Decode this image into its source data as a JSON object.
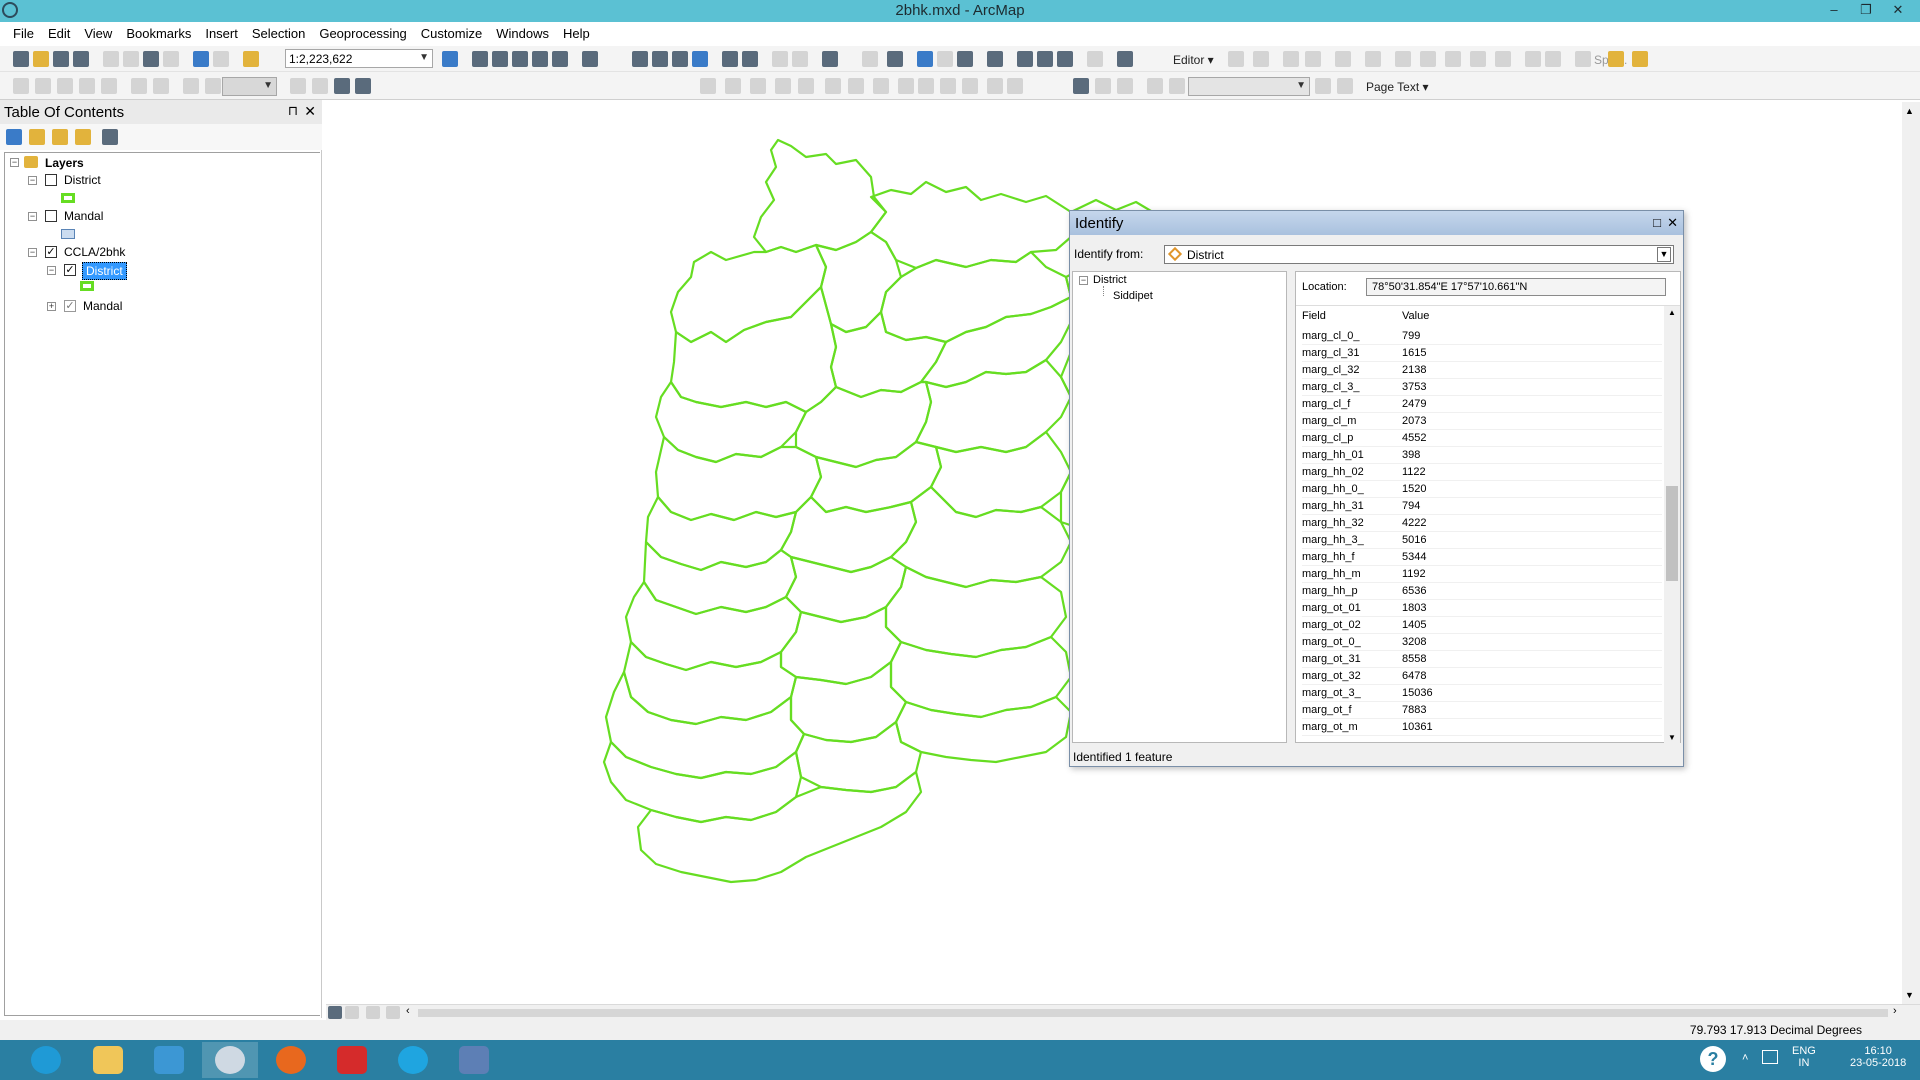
{
  "window": {
    "title": "2bhk.mxd - ArcMap",
    "min": "–",
    "max": "❐",
    "close": "✕"
  },
  "menu": [
    "File",
    "Edit",
    "View",
    "Bookmarks",
    "Insert",
    "Selection",
    "Geoprocessing",
    "Customize",
    "Windows",
    "Help"
  ],
  "toolbar": {
    "scale": "1:2,223,622",
    "editor": "Editor ▾",
    "split": "Split...",
    "page_text": "Page Text ▾"
  },
  "toc": {
    "title": "Table Of Contents",
    "pin": "⊓",
    "close": "✕",
    "layers_label": "Layers",
    "items": [
      {
        "label": "District"
      },
      {
        "label": "Mandal"
      },
      {
        "label": "CCLA/2bhk"
      },
      {
        "label": "District"
      },
      {
        "label": "Mandal"
      }
    ]
  },
  "identify": {
    "title": "Identify",
    "max": "□",
    "close": "✕",
    "from_label": "Identify from:",
    "from_value": "District",
    "tree_root": "District",
    "tree_child": "Siddipet",
    "location_label": "Location:",
    "location_value": "78°50'31.854\"E  17°57'10.661\"N",
    "col_field": "Field",
    "col_value": "Value",
    "rows": [
      {
        "f": "marg_cl_0_",
        "v": "799"
      },
      {
        "f": "marg_cl_31",
        "v": "1615"
      },
      {
        "f": "marg_cl_32",
        "v": "2138"
      },
      {
        "f": "marg_cl_3_",
        "v": "3753"
      },
      {
        "f": "marg_cl_f",
        "v": "2479"
      },
      {
        "f": "marg_cl_m",
        "v": "2073"
      },
      {
        "f": "marg_cl_p",
        "v": "4552"
      },
      {
        "f": "marg_hh_01",
        "v": "398"
      },
      {
        "f": "marg_hh_02",
        "v": "1122"
      },
      {
        "f": "marg_hh_0_",
        "v": "1520"
      },
      {
        "f": "marg_hh_31",
        "v": "794"
      },
      {
        "f": "marg_hh_32",
        "v": "4222"
      },
      {
        "f": "marg_hh_3_",
        "v": "5016"
      },
      {
        "f": "marg_hh_f",
        "v": "5344"
      },
      {
        "f": "marg_hh_m",
        "v": "1192"
      },
      {
        "f": "marg_hh_p",
        "v": "6536"
      },
      {
        "f": "marg_ot_01",
        "v": "1803"
      },
      {
        "f": "marg_ot_02",
        "v": "1405"
      },
      {
        "f": "marg_ot_0_",
        "v": "3208"
      },
      {
        "f": "marg_ot_31",
        "v": "8558"
      },
      {
        "f": "marg_ot_32",
        "v": "6478"
      },
      {
        "f": "marg_ot_3_",
        "v": "15036"
      },
      {
        "f": "marg_ot_f",
        "v": "7883"
      },
      {
        "f": "marg_ot_m",
        "v": "10361"
      }
    ],
    "footer": "Identified 1 feature"
  },
  "status": {
    "coords": "79.793  17.913 Decimal Degrees"
  },
  "tray": {
    "lang1": "ENG",
    "lang2": "IN",
    "time": "16:10",
    "date": "23-05-2018"
  },
  "colors": {
    "title_bar": "#5bc1d3",
    "map_lines": "#66dd22",
    "taskbar": "#2a7fa2",
    "selection": "#3399ff"
  }
}
